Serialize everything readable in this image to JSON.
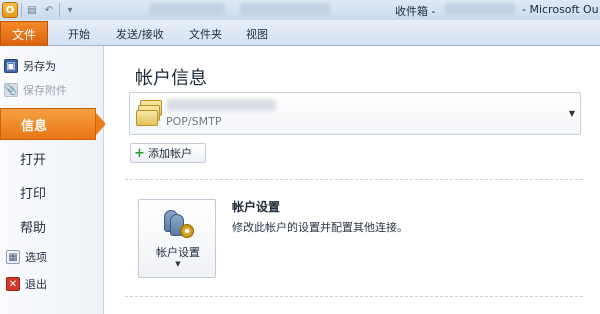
{
  "window": {
    "title_prefix": "收件箱 -",
    "title_suffix": "- Microsoft Ou"
  },
  "quick_access": {
    "app_icon": "outlook-icon",
    "buttons": [
      "send-receive-icon",
      "undo-icon",
      "customize-dropdown-icon"
    ]
  },
  "ribbon": {
    "file_tab": "文件",
    "tabs": [
      "开始",
      "发送/接收",
      "文件夹",
      "视图"
    ]
  },
  "backstage_nav": {
    "commands_top": [
      {
        "label": "另存为",
        "icon": "save-as-icon",
        "enabled": true
      },
      {
        "label": "保存附件",
        "icon": "save-attachment-icon",
        "enabled": false
      }
    ],
    "items": [
      {
        "label": "信息",
        "active": true
      },
      {
        "label": "打开",
        "active": false
      },
      {
        "label": "打印",
        "active": false
      },
      {
        "label": "帮助",
        "active": false
      }
    ],
    "commands_bottom": [
      {
        "label": "选项",
        "icon": "options-icon"
      },
      {
        "label": "退出",
        "icon": "exit-icon"
      }
    ]
  },
  "info": {
    "title": "帐户信息",
    "account": {
      "type": "POP/SMTP",
      "icon": "mail-account-icon"
    },
    "add_account_label": "添加帐户",
    "account_settings": {
      "button_label": "帐户设置",
      "heading": "帐户设置",
      "description": "修改此帐户的设置并配置其他连接。",
      "icon": "account-settings-icon"
    }
  },
  "colors": {
    "accent_orange": "#e97613",
    "ribbon_blue": "#d5e2f2"
  }
}
